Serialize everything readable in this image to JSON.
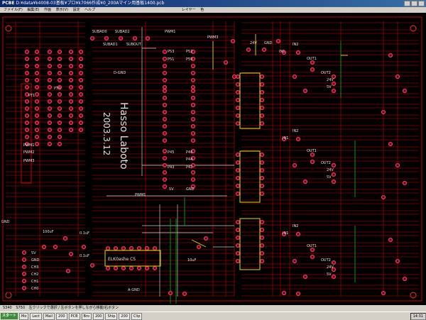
{
  "window": {
    "app_name": "PCBE",
    "file_path": "D:¥data¥k4008-03基板¥プロ¥k7066作成¥0_200Aマイン用基板1400.pcb"
  },
  "menu": [
    "ファイル(F)",
    "編集(E)",
    "作画",
    "表示(V)",
    "設定",
    "ヘルプ",
    "レイヤー",
    "色"
  ],
  "status": {
    "left": "S340",
    "mid": "S750",
    "message": "左クリックで選択 / 左ボタンを押しながら移動/右ボタン"
  },
  "taskbar": {
    "start": "スタート",
    "tasks": [
      "Mo",
      "Lect",
      "Mail",
      "200",
      "PCB",
      "Bro",
      "200",
      "Ship",
      "200",
      "Clip"
    ],
    "time": "14:31"
  },
  "silk_labels": {
    "subad0": "SUBAD0",
    "subad2": "SUBAD2",
    "subad1": "SUBAD1",
    "subout": "SUBOUT",
    "pwm1": "PWM1",
    "pwm3": "PWM3",
    "dgnd": "D-GND",
    "agnd": "A-GND",
    "pt1": "PT1",
    "pt0": "PT0",
    "pwm1b": "PWM1",
    "pwm2": "PWM2",
    "pwm3b": "PWM3",
    "gnd": "GND",
    "p52": "P52",
    "p50": "P50",
    "p53": "P53",
    "p51": "P51",
    "p45": "P45",
    "p44": "P44",
    "p42": "P42",
    "p46": "P46",
    "p43": "P43",
    "v5": "5V",
    "vgnd": "GND",
    "in1a": "IN1",
    "in2a": "IN2",
    "out1a": "OUT1",
    "out2a": "OUT2",
    "v24a": "24V",
    "v5a": "5V",
    "in1b": "IN1",
    "in2b": "IN2",
    "out1b": "OUT1",
    "out2b": "OUT2",
    "v24b": "24V",
    "v5b": "5V",
    "in1c": "IN1",
    "in2c": "IN2",
    "out1c": "OUT1",
    "out2c": "OUT2",
    "v24c": "24V",
    "v5c": "5V",
    "v24top": "24V",
    "gndtop": "GND",
    "c100u": "100uF",
    "c01u": "0.1uF",
    "c10u": "10uF",
    "c01ub": "0.1uF",
    "ch3": "CH3",
    "ch2": "CH2",
    "ch1": "CH1",
    "ch0": "CH0",
    "gndch": "GND",
    "v5ch": "5V",
    "ic_label": "ELK0ashe CS",
    "author_line1": "Hasso Laboto",
    "author_line2": "2003.3.12",
    "lpwm": "PWM1"
  }
}
